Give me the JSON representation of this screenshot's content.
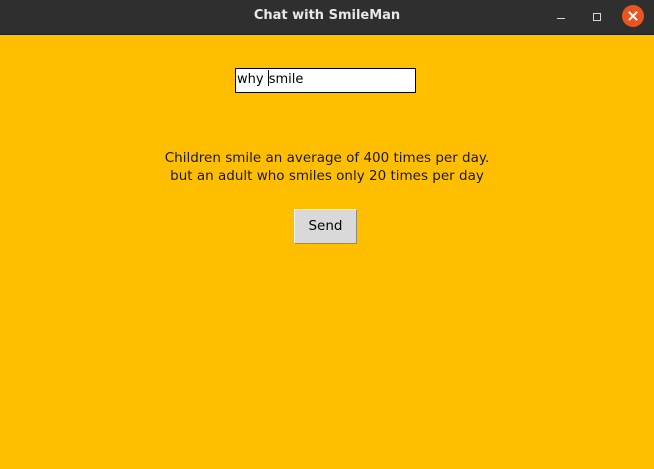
{
  "window": {
    "title": "Chat with SmileMan"
  },
  "entry": {
    "value_before_caret": "why ",
    "value_after_caret": "smile"
  },
  "message": {
    "line1": "Children smile an average of 400 times per day.",
    "line2": "but an adult who smiles only 20 times per day"
  },
  "send_button": {
    "label": "Send"
  },
  "colors": {
    "background": "#ffbf00",
    "titlebar": "#2f2f2f",
    "close_button": "#e95420"
  },
  "icons": {
    "minimize": "minimize-icon",
    "maximize": "maximize-icon",
    "close": "close-icon"
  }
}
